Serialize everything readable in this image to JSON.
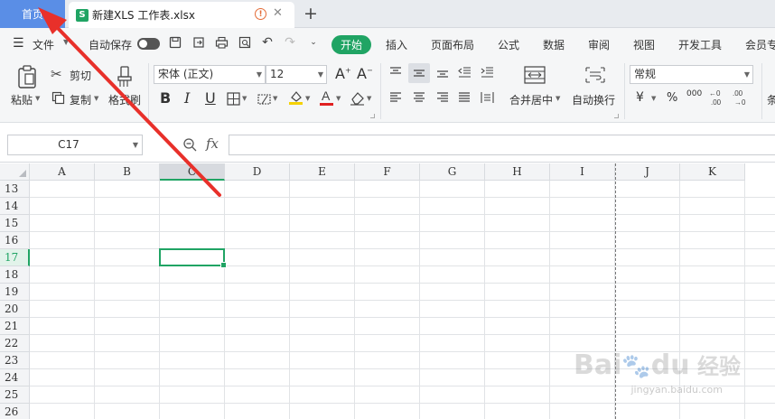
{
  "tabs": {
    "home": "首页",
    "doc_title": "新建XLS 工作表.xlsx",
    "new_tab": "+"
  },
  "menu": {
    "file": "文件",
    "autosave": "自动保存",
    "start": "开始",
    "insert": "插入",
    "page_layout": "页面布局",
    "formula": "公式",
    "data": "数据",
    "review": "审阅",
    "view": "视图",
    "dev_tools": "开发工具",
    "member": "会员专"
  },
  "ribbon": {
    "paste": "粘贴",
    "cut": "剪切",
    "copy": "复制",
    "format_painter": "格式刷",
    "font_name": "宋体 (正文)",
    "font_size": "12",
    "merge_center": "合并居中",
    "wrap_text": "自动换行",
    "number_format": "常规",
    "percent": "%",
    "thousands": "000",
    "cond": "条"
  },
  "formula_bar": {
    "cell_ref": "C17",
    "fx": "fx"
  },
  "sheet": {
    "columns": [
      "A",
      "B",
      "C",
      "D",
      "E",
      "F",
      "G",
      "H",
      "I",
      "J",
      "K"
    ],
    "rows": [
      "13",
      "14",
      "15",
      "16",
      "17",
      "18",
      "19",
      "20",
      "21",
      "22",
      "23",
      "24",
      "25",
      "26"
    ],
    "selected_column": "C",
    "selected_row": "17"
  },
  "watermark": {
    "logo": "Bai du 经验",
    "url": "jingyan.baidu.com"
  },
  "colors": {
    "accent": "#20a464",
    "home_tab": "#5a8ee6",
    "arrow": "#e8302a"
  }
}
